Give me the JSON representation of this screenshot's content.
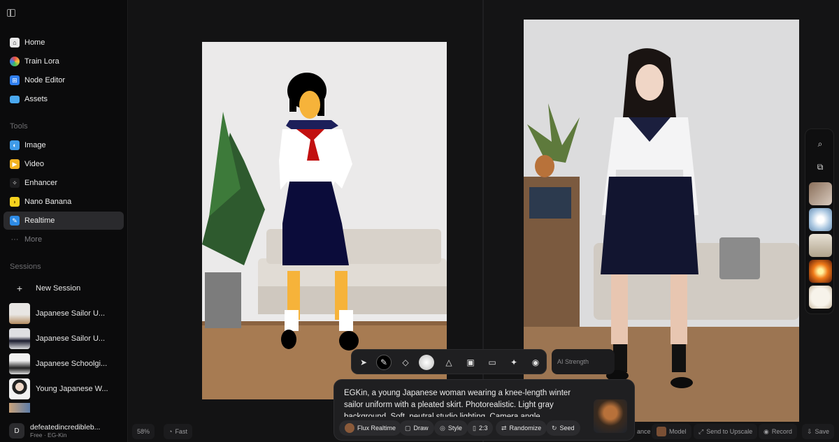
{
  "sidebar": {
    "nav": [
      {
        "label": "Home",
        "icon": "home-icon"
      },
      {
        "label": "Train Lora",
        "icon": "train-lora-icon"
      },
      {
        "label": "Node Editor",
        "icon": "node-editor-icon"
      },
      {
        "label": "Assets",
        "icon": "folder-icon"
      }
    ],
    "tools_label": "Tools",
    "tools": [
      {
        "label": "Image",
        "icon": "image-icon"
      },
      {
        "label": "Video",
        "icon": "video-icon"
      },
      {
        "label": "Enhancer",
        "icon": "enhancer-icon"
      },
      {
        "label": "Nano Banana",
        "icon": "banana-icon"
      },
      {
        "label": "Realtime",
        "icon": "realtime-icon",
        "active": true
      },
      {
        "label": "More",
        "icon": "more-icon"
      }
    ],
    "sessions_label": "Sessions",
    "new_session": "New Session",
    "sessions": [
      {
        "label": "Japanese Sailor U..."
      },
      {
        "label": "Japanese Sailor U..."
      },
      {
        "label": "Japanese Schoolgi..."
      },
      {
        "label": "Young Japanese W..."
      }
    ],
    "user": {
      "initial": "D",
      "name": "defeatedincredibleb...",
      "plan": "Free · EG-Kin"
    }
  },
  "toolbar": {
    "ai_strength_placeholder": "AI Strength"
  },
  "prompt": {
    "text": "EGKin, a young Japanese woman wearing a knee-length winter sailor uniform with a pleated skirt. Photorealistic. Light gray background. Soft, neutral studio lighting. Camera angle",
    "chips": {
      "model": "Flux Realtime",
      "draw": "Draw",
      "style": "Style",
      "ratio": "2:3",
      "randomize": "Randomize",
      "seed": "Seed"
    }
  },
  "bottom_bar": {
    "zoom": "58%",
    "speed": "Fast",
    "enhance": "ance",
    "model": "Model",
    "upscale": "Send to Upscale",
    "record": "Record",
    "save": "Save"
  },
  "colors": {
    "active": "#2a2a2d",
    "panel": "#1f1f21",
    "skirt": "#0b0c3a",
    "skin": "#f6b33a"
  }
}
